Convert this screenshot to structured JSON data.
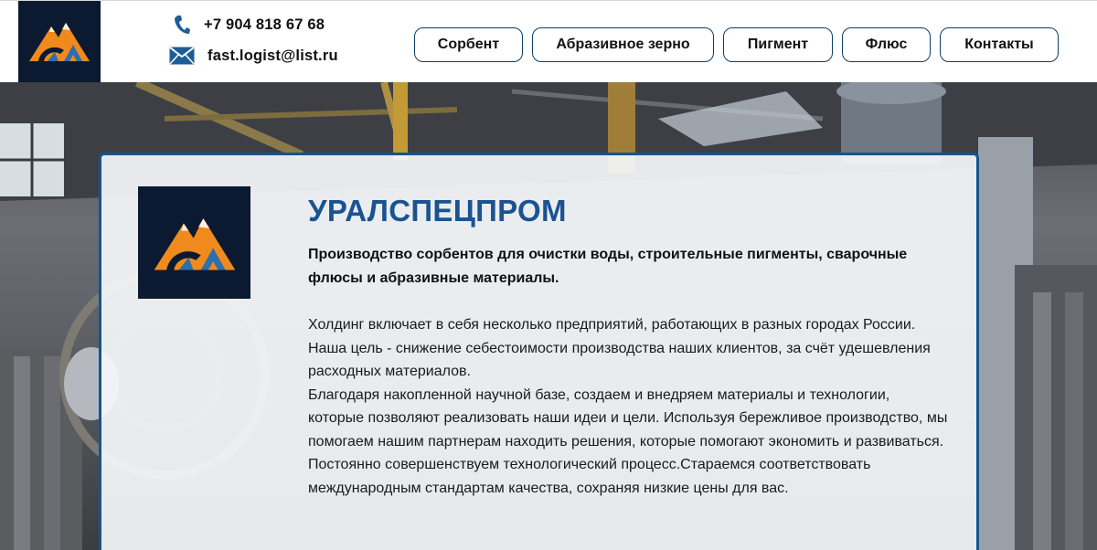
{
  "header": {
    "logo_name": "mountain-gear-logo",
    "phone": "+7 904 818 67 68",
    "email": "fast.logist@list.ru",
    "phone_icon": "phone-icon",
    "email_icon": "envelope-icon"
  },
  "nav": {
    "items": [
      {
        "label": "Сорбент"
      },
      {
        "label": "Абразивное зерно"
      },
      {
        "label": "Пигмент"
      },
      {
        "label": "Флюс"
      },
      {
        "label": "Контакты"
      }
    ]
  },
  "about": {
    "company_name": "УРАЛСПЕЦПРОМ",
    "tagline": "Производство сорбентов для очистки воды, строительные пигменты, сварочные флюсы и абразивные материалы.",
    "paragraphs": [
      "Холдинг включает в себя несколько предприятий, работающих в разных городах России. Наша цель - снижение себестоимости производства наших клиентов, за счёт удешевления расходных материалов.",
      "Благодаря накопленной научной базе, создаем и внедряем материалы и технологии, которые позволяют реализовать наши идеи и цели. Используя бережливое производство, мы помогаем нашим партнерам находить решения, которые помогают экономить и развиваться.",
      "Постоянно совершенствуем технологический процесс.Стараемся соответствовать международным стандартам качества, сохраняя низкие цены для вас."
    ]
  },
  "colors": {
    "brand_blue": "#1a5390",
    "logo_bg": "#0b1a30",
    "logo_orange": "#f08a1c",
    "nav_border": "#0d3f6b",
    "card_border": "#15558d"
  }
}
